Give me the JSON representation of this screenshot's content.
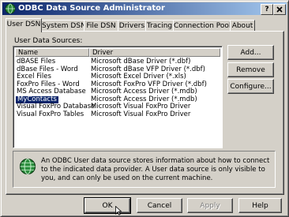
{
  "window": {
    "title": "ODBC Data Source Administrator",
    "help_btn": "?",
    "close_btn": "x"
  },
  "tabs": [
    {
      "label": "User DSN",
      "active": true
    },
    {
      "label": "System DSN"
    },
    {
      "label": "File DSN"
    },
    {
      "label": "Drivers"
    },
    {
      "label": "Tracing"
    },
    {
      "label": "Connection Pooling"
    },
    {
      "label": "About"
    }
  ],
  "user_dsn": {
    "section_label": "User Data Sources:",
    "columns": [
      "Name",
      "Driver"
    ],
    "rows": [
      {
        "name": "dBASE Files",
        "driver": "Microsoft dBase Driver (*.dbf)"
      },
      {
        "name": "dBase Files - Word",
        "driver": "Microsoft dBase VFP Driver (*.dbf)"
      },
      {
        "name": "Excel Files",
        "driver": "Microsoft Excel Driver (*.xls)"
      },
      {
        "name": "FoxPro Files - Word",
        "driver": "Microsoft FoxPro VFP Driver (*.dbf)"
      },
      {
        "name": "MS Access Database",
        "driver": "Microsoft Access Driver (*.mdb)"
      },
      {
        "name": "MyContacts",
        "driver": "Microsoft Access Driver (*.mdb)",
        "selected": true
      },
      {
        "name": "Visual FoxPro Database",
        "driver": "Microsoft Visual FoxPro Driver"
      },
      {
        "name": "Visual FoxPro Tables",
        "driver": "Microsoft Visual FoxPro Driver"
      }
    ],
    "buttons": {
      "add": "Add...",
      "remove": "Remove",
      "configure": "Configure..."
    },
    "info_text": "An ODBC User data source stores information about how to connect to the indicated data provider.  A User data source is only visible to you, and can only be used on the current machine."
  },
  "footer": {
    "ok": "OK",
    "cancel": "Cancel",
    "apply": "Apply",
    "help": "Help"
  }
}
